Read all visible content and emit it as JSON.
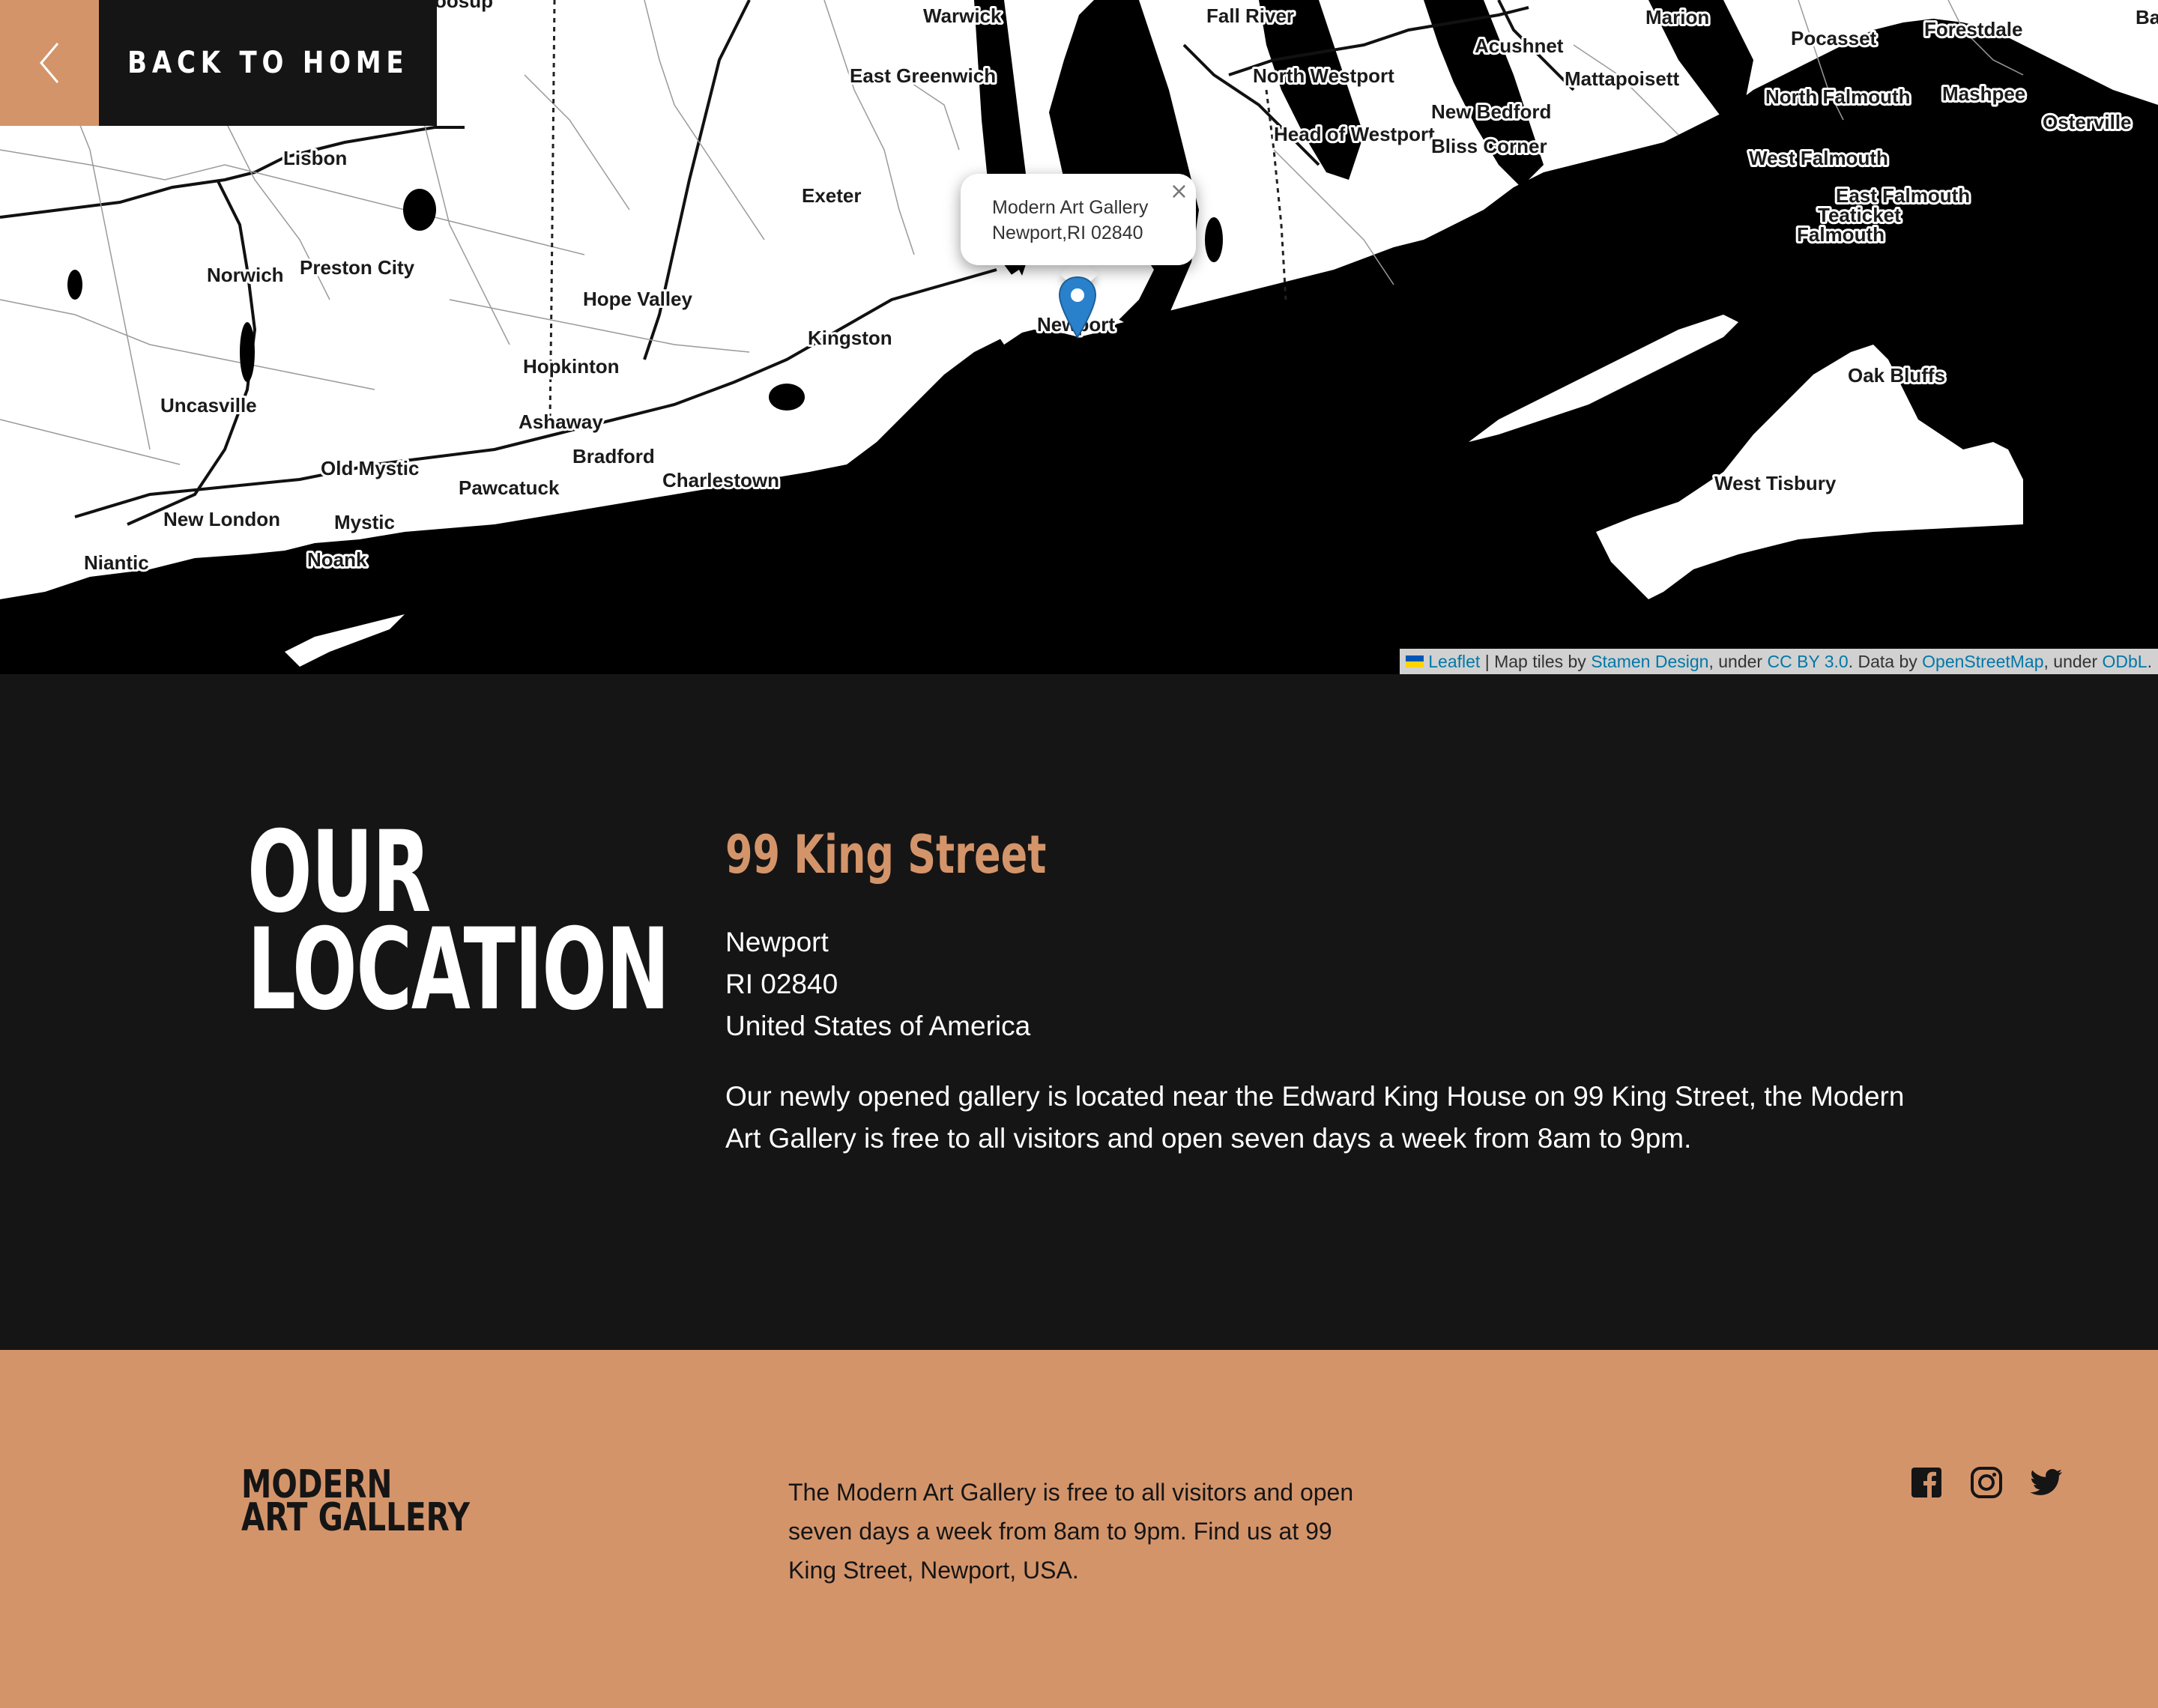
{
  "nav": {
    "back_label": "BACK TO HOME"
  },
  "map": {
    "popup": {
      "line1": "Modern Art Gallery",
      "line2": "Newport,RI 02840",
      "close": "×"
    },
    "labels": {
      "warwick": "Warwick",
      "fall_river": "Fall River",
      "marion": "Marion",
      "forestdale": "Forestdale",
      "ba": "Ba",
      "east_greenwich": "East Greenwich",
      "north_westport": "North Westport",
      "acushnet": "Acushnet",
      "mattapoisett": "Mattapoisett",
      "pocasset": "Pocasset",
      "north_falmouth": "North Falmouth",
      "mashpee": "Mashpee",
      "osterville": "Osterville",
      "new_bedford": "New Bedford",
      "head_of_westport": "Head of Westport",
      "bliss_corner": "Bliss Corner",
      "west_falmouth": "West Falmouth",
      "lisbon": "Lisbon",
      "exeter": "Exeter",
      "east_falmouth": "East Falmouth",
      "teaticket": "Teaticket",
      "falmouth": "Falmouth",
      "norwich": "Norwich",
      "preston_city": "Preston City",
      "hope_valley": "Hope Valley",
      "kingston": "Kingston",
      "newport": "Newport",
      "hopkinton": "Hopkinton",
      "oak_bluffs": "Oak Bluffs",
      "uncasville": "Uncasville",
      "ashaway": "Ashaway",
      "bradford": "Bradford",
      "old_mystic": "Old Mystic",
      "charlestown": "Charlestown",
      "pawcatuck": "Pawcatuck",
      "west_tisbury": "West Tisbury",
      "new_london": "New London",
      "mystic": "Mystic",
      "niantic": "Niantic",
      "noank": "Noank",
      "oosup": "oosup"
    },
    "attribution": {
      "leaflet": "Leaflet",
      "sep": " | Map tiles by ",
      "stamen": "Stamen Design",
      "under1": ", under ",
      "ccby": "CC BY 3.0",
      "data_by": ". Data by ",
      "osm": "OpenStreetMap",
      "under2": ", under ",
      "odbl": "ODbL",
      "end": "."
    }
  },
  "location": {
    "title_line1": "OUR",
    "title_line2": "LOCATION",
    "street": "99 King Street",
    "city": "Newport",
    "state_zip": "RI 02840",
    "country": "United States of America",
    "description": "Our newly opened gallery is located near the Edward King House on 99 King Street, the Modern Art Gallery is free to all visitors and open seven days a week from 8am to 9pm."
  },
  "footer": {
    "logo_line1": "MODERN",
    "logo_line2": "ART GALLERY",
    "text": "The Modern Art Gallery is free to all visitors and open seven days a week from 8am to 9pm. Find us at 99 King Street, Newport, USA.",
    "social": [
      "facebook-icon",
      "instagram-icon",
      "twitter-icon"
    ]
  },
  "colors": {
    "accent": "#d4946a",
    "dark": "#151515",
    "link": "#0078a8",
    "marker": "#2a81cb"
  }
}
